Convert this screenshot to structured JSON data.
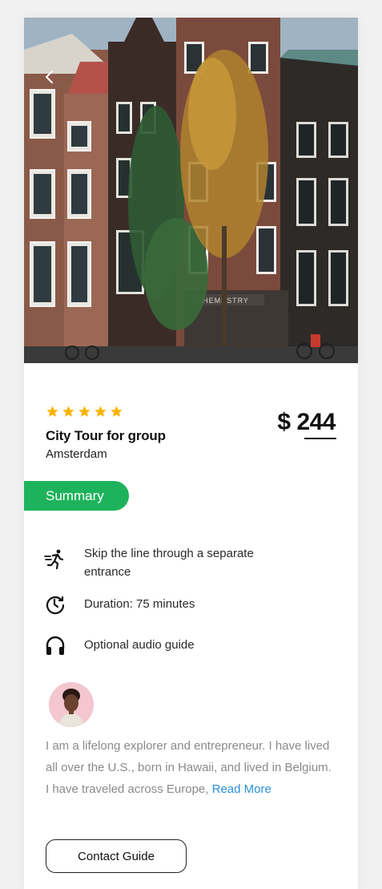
{
  "colors": {
    "accent_green": "#1db35c",
    "star_yellow": "#f7b500",
    "link_blue": "#2a8fd8"
  },
  "hero": {
    "back_icon": "chevron-left-icon",
    "sign_text": "HEMPSTRY"
  },
  "tour": {
    "rating": 5,
    "title": "City Tour for group",
    "location": "Amsterdam",
    "price": "$ 244"
  },
  "summary": {
    "label": "Summary"
  },
  "features": [
    {
      "icon": "running-person-icon",
      "text": "Skip the line through a separate entrance"
    },
    {
      "icon": "clock-icon",
      "text": "Duration: 75 minutes"
    },
    {
      "icon": "headphones-icon",
      "text": "Optional audio guide"
    }
  ],
  "guide": {
    "bio": "I am a lifelong explorer and entrepreneur. I have lived all over the U.S., born in Hawaii, and lived in Belgium. I have traveled across Europe, ",
    "read_more": "Read More",
    "contact_label": "Contact Guide"
  }
}
